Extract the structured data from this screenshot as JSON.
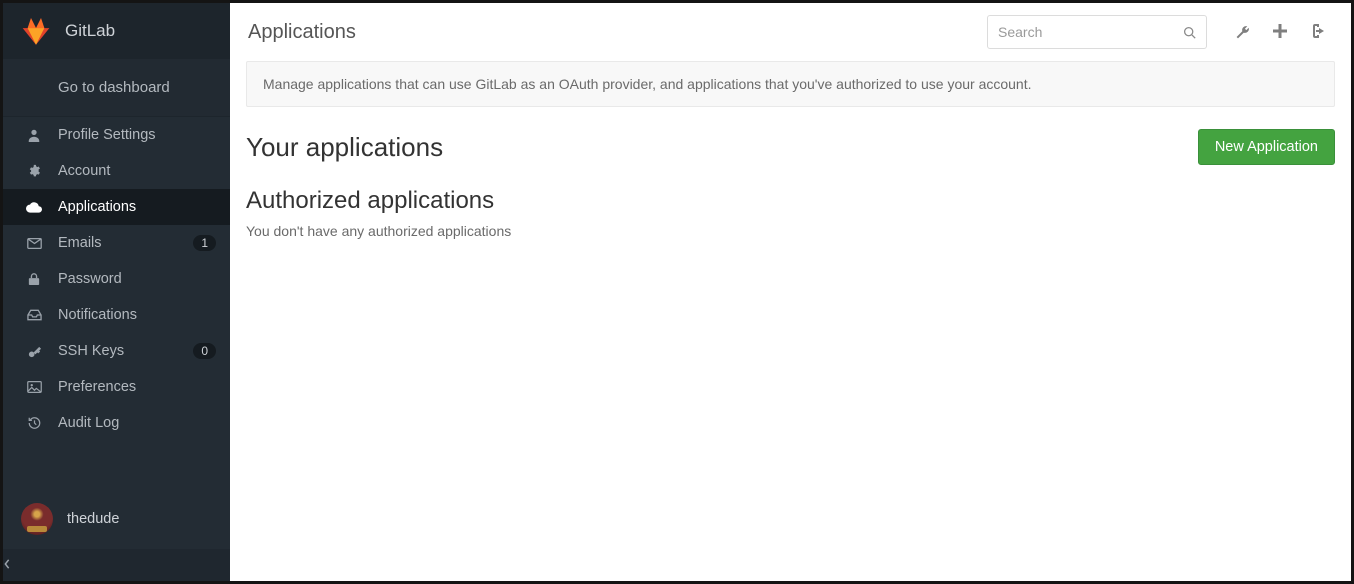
{
  "brand": {
    "name": "GitLab"
  },
  "sidebar": {
    "go_dashboard": "Go to dashboard",
    "items": [
      {
        "icon": "user-icon",
        "label": "Profile Settings",
        "active": false
      },
      {
        "icon": "gear-icon",
        "label": "Account",
        "active": false
      },
      {
        "icon": "cloud-icon",
        "label": "Applications",
        "active": true
      },
      {
        "icon": "envelope-icon",
        "label": "Emails",
        "active": false,
        "badge": "1"
      },
      {
        "icon": "lock-icon",
        "label": "Password",
        "active": false
      },
      {
        "icon": "inbox-icon",
        "label": "Notifications",
        "active": false
      },
      {
        "icon": "key-icon",
        "label": "SSH Keys",
        "active": false,
        "badge": "0"
      },
      {
        "icon": "image-icon",
        "label": "Preferences",
        "active": false
      },
      {
        "icon": "history-icon",
        "label": "Audit Log",
        "active": false
      }
    ],
    "user": {
      "name": "thedude"
    }
  },
  "header": {
    "title": "Applications",
    "search_placeholder": "Search"
  },
  "banner": {
    "text": "Manage applications that can use GitLab as an OAuth provider, and applications that you've authorized to use your account."
  },
  "main": {
    "your_applications_heading": "Your applications",
    "new_application_label": "New Application",
    "authorized_heading": "Authorized applications",
    "empty_text": "You don't have any authorized applications"
  }
}
